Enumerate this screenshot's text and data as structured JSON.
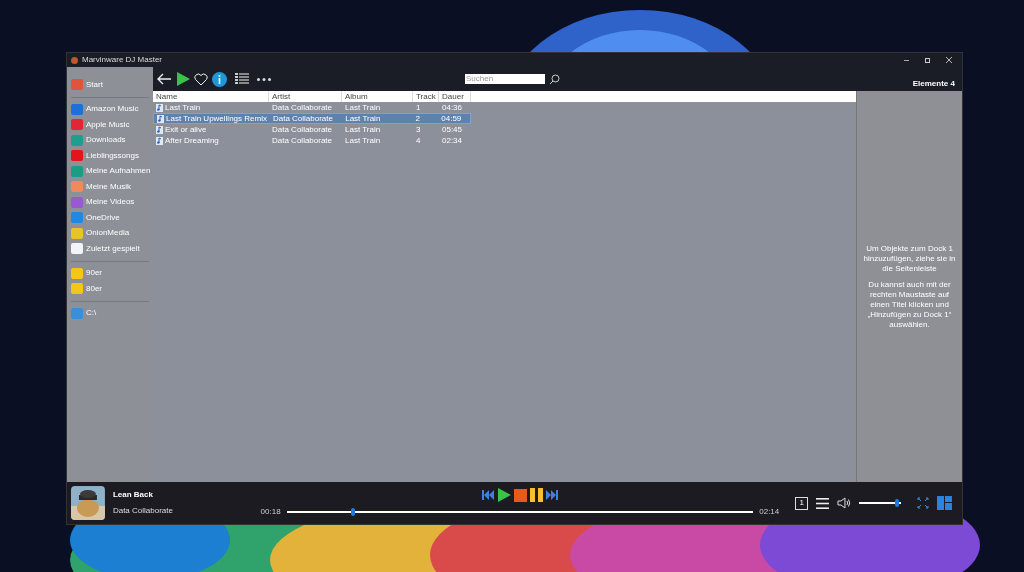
{
  "window": {
    "title": "Marvinware DJ Master"
  },
  "sidebar": {
    "groups": [
      [
        {
          "label": "Start",
          "color": "#e0533f"
        }
      ],
      [
        {
          "label": "Amazon Music",
          "color": "#1e6fd9"
        },
        {
          "label": "Apple Music",
          "color": "#e32636"
        },
        {
          "label": "Downloads",
          "color": "#1f9e8e"
        },
        {
          "label": "Lieblingssongs",
          "color": "#e3141b"
        },
        {
          "label": "Meine Aufnahmen",
          "color": "#1b9c85"
        },
        {
          "label": "Meine Musik",
          "color": "#f08a5d"
        },
        {
          "label": "Meine Videos",
          "color": "#9b59d0"
        },
        {
          "label": "OneDrive",
          "color": "#1e88e5"
        },
        {
          "label": "OnionMedia",
          "color": "#e8c32a"
        },
        {
          "label": "Zuletzt gespielt",
          "color": "#f2f4f8"
        }
      ],
      [
        {
          "label": "90er",
          "color": "#f5c518"
        },
        {
          "label": "80er",
          "color": "#f5c518"
        }
      ],
      [
        {
          "label": "C:\\",
          "color": "#3b8fd9"
        }
      ]
    ]
  },
  "search": {
    "placeholder": "Suchen"
  },
  "item_count": "Elemente 4",
  "table": {
    "columns": [
      "Name",
      "Artist",
      "Album",
      "Track",
      "Dauer"
    ],
    "rows": [
      {
        "cells": [
          "Last Train",
          "Data Collaborate",
          "Last Train",
          "1",
          "04:36"
        ],
        "selected": false
      },
      {
        "cells": [
          "Last Train Upwellings Remix",
          "Data Collaborate",
          "Last Train",
          "2",
          "04:59"
        ],
        "selected": true
      },
      {
        "cells": [
          "Exit or alive",
          "Data Collaborate",
          "Last Train",
          "3",
          "05:45"
        ],
        "selected": false
      },
      {
        "cells": [
          "After Dreaming",
          "Data Collaborate",
          "Last Train",
          "4",
          "02:34"
        ],
        "selected": false
      }
    ]
  },
  "dock": {
    "hint": [
      "Um Objekte zum Dock 1 hinzuzufügen, ziehe sie in die Seitenleiste",
      "Du kannst auch mit der rechten Maustaste auf einen Titel klicken und „Hinzufügen zu Dock 1“ auswählen."
    ]
  },
  "player": {
    "title": "Lean Back",
    "artist": "Data Collaborate",
    "elapsed": "00:18",
    "total": "02:14",
    "level": 0.14,
    "dock_number": "1",
    "volume": {
      "level": 0.95
    }
  }
}
